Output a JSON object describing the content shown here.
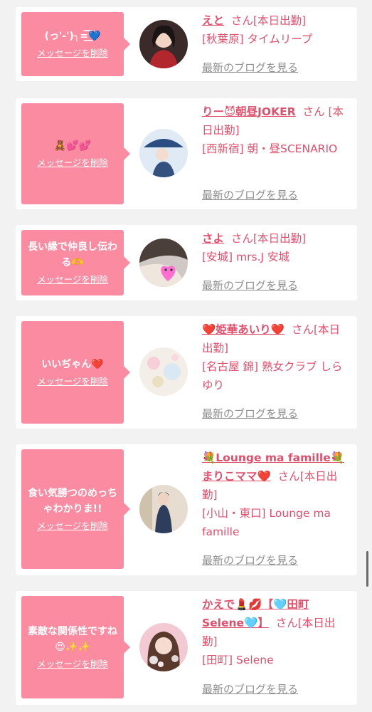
{
  "entries": [
    {
      "message": "(っ'-')╮=͟͟͞͞💙",
      "delete_label": "メッセージを削除",
      "name": "えと",
      "honorific": "さん",
      "status": "[本日出勤]",
      "shop": "[秋葉原] タイムリープ",
      "blog_label": "最新のブログを見る"
    },
    {
      "message": "🧸💕💕",
      "delete_label": "メッセージを削除",
      "name": "りー😈朝昼JOKER",
      "honorific": "さん",
      "status": "[本日出勤]",
      "shop": "[西新宿] 朝・昼SCENARIO",
      "blog_label": "最新のブログを見る"
    },
    {
      "message": "長い縁で仲良し伝わる🫶",
      "delete_label": "メッセージを削除",
      "name": "さよ",
      "honorific": "さん",
      "status": "[本日出勤]",
      "shop": "[安城] mrs.J 安城",
      "blog_label": "最新のブログを見る"
    },
    {
      "message": "いいぢゃん❤️",
      "delete_label": "メッセージを削除",
      "name": "❤️姫華あいり❤️",
      "honorific": "さん",
      "status": "[本日出勤]",
      "shop": "[名古屋 錦] 熟女クラブ しらゆり",
      "blog_label": "最新のブログを見る"
    },
    {
      "message": "食い気勝つのめっちゃわかりま!!",
      "delete_label": "メッセージを削除",
      "name": "💐Lounge ma famille💐まりこママ❤️",
      "honorific": "さん",
      "status": "[本日出勤]",
      "shop": "[小山・東口] Lounge ma famille",
      "blog_label": "最新のブログを見る"
    },
    {
      "message": "素敵な関係性ですね😍✨✨",
      "delete_label": "メッセージを削除",
      "name": "かえで💄💋【🩵田町Selene🩵】",
      "honorific": "さん",
      "status": "[本日出勤]",
      "shop": "[田町] Selene",
      "blog_label": "最新のブログを見る"
    }
  ]
}
